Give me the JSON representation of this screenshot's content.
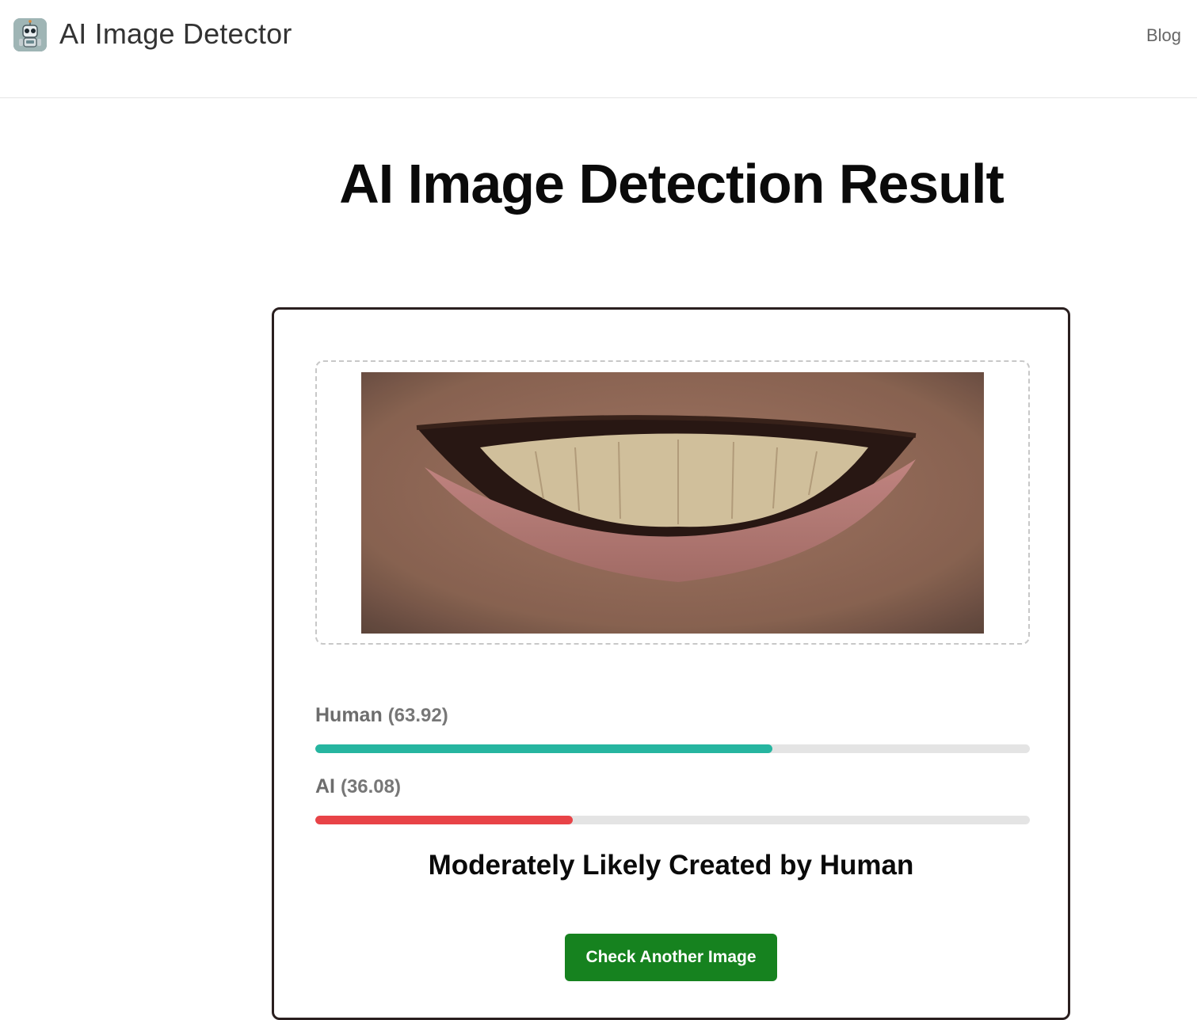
{
  "header": {
    "brand": "AI Image Detector",
    "logo_icon": "robot-icon",
    "nav": {
      "blog_label": "Blog"
    }
  },
  "page": {
    "title": "AI Image Detection Result"
  },
  "result": {
    "scores": [
      {
        "label": "Human",
        "value_text": "(63.92)",
        "value": 63.92,
        "color": "#26b5a0"
      },
      {
        "label": "AI",
        "value_text": "(36.08)",
        "value": 36.08,
        "color": "#e84347"
      }
    ],
    "verdict": "Moderately Likely Created by Human",
    "action_label": "Check Another Image",
    "action_color": "#16821f"
  }
}
